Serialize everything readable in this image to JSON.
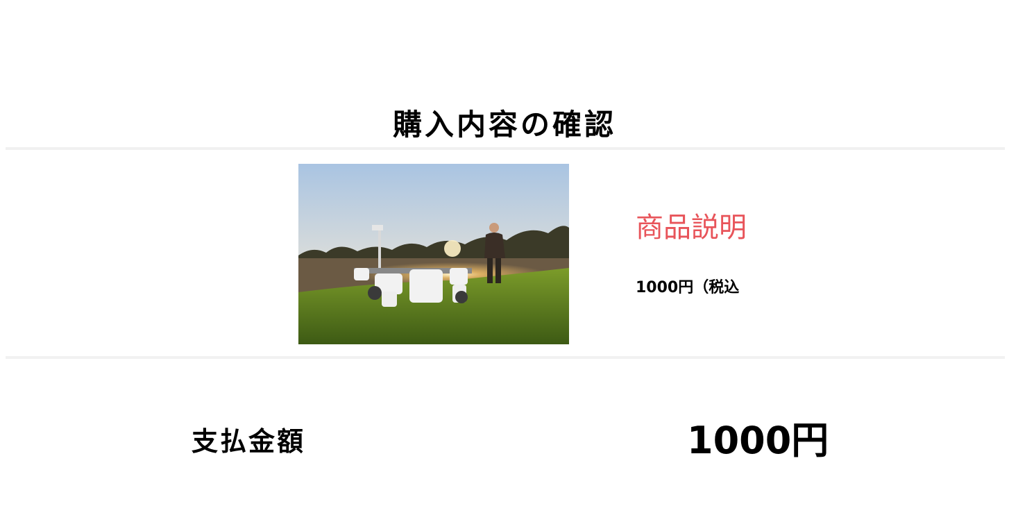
{
  "page_title": "購入内容の確認",
  "product": {
    "image_icon": "product-photo",
    "name": "商品説明",
    "price": "1000円（税込"
  },
  "payment": {
    "label": "支払金額",
    "amount": "1000円"
  },
  "colors": {
    "accent": "#e8545a",
    "divider": "#f1f1f1"
  }
}
